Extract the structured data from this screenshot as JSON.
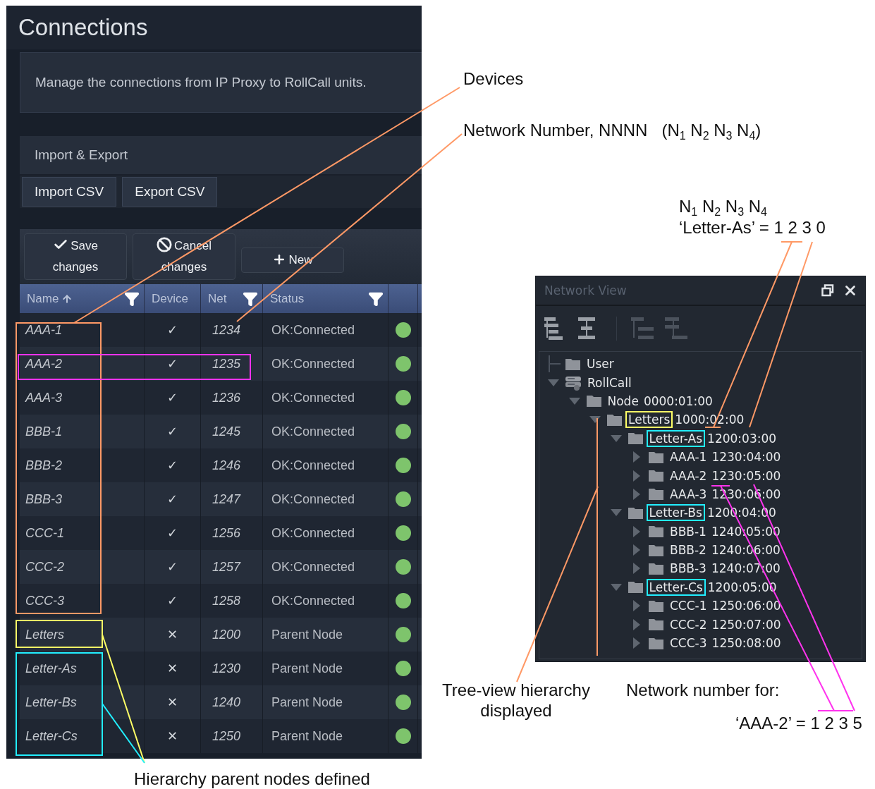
{
  "page": {
    "title": "Connections",
    "description": "Manage the connections from IP Proxy to RollCall units."
  },
  "import_export": {
    "title": "Import & Export",
    "buttons": [
      "Import CSV",
      "Export CSV"
    ]
  },
  "toolbar": [
    {
      "kind": "save",
      "label": "Save changes"
    },
    {
      "kind": "cancel",
      "label": "Cancel changes"
    },
    {
      "kind": "new",
      "label": "New"
    }
  ],
  "table": {
    "columns": [
      {
        "label": "Name",
        "sorted": true,
        "filter": true
      },
      {
        "label": "Device",
        "sorted": false,
        "filter": false
      },
      {
        "label": "Net",
        "sorted": false,
        "filter": true
      },
      {
        "label": "Status",
        "sorted": false,
        "filter": true
      }
    ],
    "rows": [
      {
        "name": "AAA-1",
        "device": "✓",
        "net": "1234",
        "status": "OK:Connected"
      },
      {
        "name": "AAA-2",
        "device": "✓",
        "net": "1235",
        "status": "OK:Connected"
      },
      {
        "name": "AAA-3",
        "device": "✓",
        "net": "1236",
        "status": "OK:Connected"
      },
      {
        "name": "BBB-1",
        "device": "✓",
        "net": "1245",
        "status": "OK:Connected"
      },
      {
        "name": "BBB-2",
        "device": "✓",
        "net": "1246",
        "status": "OK:Connected"
      },
      {
        "name": "BBB-3",
        "device": "✓",
        "net": "1247",
        "status": "OK:Connected"
      },
      {
        "name": "CCC-1",
        "device": "✓",
        "net": "1256",
        "status": "OK:Connected"
      },
      {
        "name": "CCC-2",
        "device": "✓",
        "net": "1257",
        "status": "OK:Connected"
      },
      {
        "name": "CCC-3",
        "device": "✓",
        "net": "1258",
        "status": "OK:Connected"
      },
      {
        "name": "Letters",
        "device": "✕",
        "net": "1200",
        "status": "Parent Node"
      },
      {
        "name": "Letter-As",
        "device": "✕",
        "net": "1230",
        "status": "Parent Node"
      },
      {
        "name": "Letter-Bs",
        "device": "✕",
        "net": "1240",
        "status": "Parent Node"
      },
      {
        "name": "Letter-Cs",
        "device": "✕",
        "net": "1250",
        "status": "Parent Node"
      }
    ]
  },
  "network_view": {
    "title": "Network View",
    "tree_toolbar": [
      {
        "disabled": false
      },
      {
        "disabled": false
      },
      {
        "disabled": true
      },
      {
        "disabled": true
      }
    ],
    "tree": [
      {
        "kind": "folder",
        "name": "User"
      },
      {
        "kind": "server",
        "name": "RollCall",
        "expanded": true,
        "children": [
          {
            "kind": "folder",
            "name": "Node",
            "address": "0000:01:00",
            "expanded": true,
            "children": [
              {
                "kind": "folder",
                "name": "Letters",
                "address": "1000:02:00",
                "expanded": true,
                "color": "#ffff66",
                "children": [
                  {
                    "kind": "folder",
                    "name": "Letter-As",
                    "address": "1200:03:00",
                    "expanded": true,
                    "color": "#22eeff",
                    "children": [
                      {
                        "kind": "folder",
                        "name": "AAA-1",
                        "address": "1230:04:00",
                        "expanded": false
                      },
                      {
                        "kind": "folder",
                        "name": "AAA-2",
                        "address": "1230:05:00",
                        "expanded": false
                      },
                      {
                        "kind": "folder",
                        "name": "AAA-3",
                        "address": "1230:06:00",
                        "expanded": false
                      }
                    ]
                  },
                  {
                    "kind": "folder",
                    "name": "Letter-Bs",
                    "address": "1200:04:00",
                    "expanded": true,
                    "color": "#22eeff",
                    "children": [
                      {
                        "kind": "folder",
                        "name": "BBB-1",
                        "address": "1240:05:00",
                        "expanded": false
                      },
                      {
                        "kind": "folder",
                        "name": "BBB-2",
                        "address": "1240:06:00",
                        "expanded": false
                      },
                      {
                        "kind": "folder",
                        "name": "BBB-3",
                        "address": "1240:07:00",
                        "expanded": false
                      }
                    ]
                  },
                  {
                    "kind": "folder",
                    "name": "Letter-Cs",
                    "address": "1200:05:00",
                    "expanded": true,
                    "color": "#22eeff",
                    "children": [
                      {
                        "kind": "folder",
                        "name": "CCC-1",
                        "address": "1250:06:00",
                        "expanded": false
                      },
                      {
                        "kind": "folder",
                        "name": "CCC-2",
                        "address": "1250:07:00",
                        "expanded": false
                      },
                      {
                        "kind": "folder",
                        "name": "CCC-3",
                        "address": "1250:08:00",
                        "expanded": false
                      }
                    ]
                  }
                ]
              }
            ]
          }
        ]
      }
    ]
  },
  "annotations": [
    {
      "text": "Devices"
    },
    {
      "text": "Network Number, NNNN   (N$_{1}$ N$_{2}$ N$_{3}$ N$_{4}$)"
    },
    {
      "text": "N$_{1}$ N$_{2}$ N$_{3}$ N$_{4}$"
    },
    {
      "text": "‘Letter-As’ = 1 2 3 0"
    },
    {
      "text": "Tree-view hierarchy displayed"
    },
    {
      "text": "Network number for:"
    },
    {
      "text": "‘AAA-2’ = 1 2 3 5"
    },
    {
      "text": "Hierarchy parent nodes defined"
    }
  ]
}
